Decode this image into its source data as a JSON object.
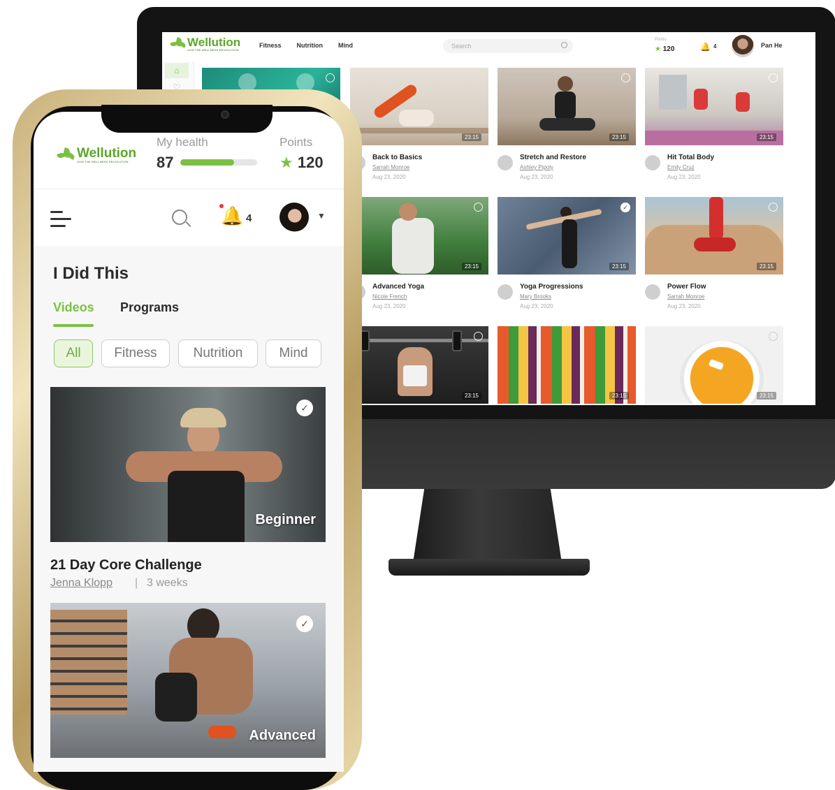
{
  "brand": {
    "name": "Wellution",
    "tagline": "JOIN THE WELLNESS REVOLUTION",
    "accent": "#7bc043"
  },
  "desktop": {
    "nav": [
      "Fitness",
      "Nutrition",
      "Mind"
    ],
    "search_placeholder": "Search",
    "points_label": "Points",
    "points_value": "120",
    "notifications": "4",
    "user_name": "Pan He",
    "rail_icons": [
      "home-icon",
      "heart-icon"
    ],
    "videos": [
      {
        "title": "",
        "author": "",
        "date": "",
        "duration": "",
        "status": "clock"
      },
      {
        "title": "Back to Basics",
        "author": "Sarrah Monroe",
        "date": "Aug 23, 2020",
        "duration": "23:15",
        "status": ""
      },
      {
        "title": "Stretch and Restore",
        "author": "Ashley Pipoly",
        "date": "Aug 23, 2020",
        "duration": "23:15",
        "status": "clock"
      },
      {
        "title": "Hit Total Body",
        "author": "Emily Cruz",
        "date": "Aug 23, 2020",
        "duration": "23:15",
        "status": "clock"
      },
      {
        "title": "Advanced Yoga",
        "author": "Nicole French",
        "date": "Aug 23, 2020",
        "duration": "23:15",
        "status": "clock"
      },
      {
        "title": "Yoga Progressions",
        "author": "Mary Brooks",
        "date": "Aug 23, 2020",
        "duration": "23:15",
        "status": "check"
      },
      {
        "title": "Power Flow",
        "author": "Sarrah Monroe",
        "date": "Aug 23, 2020",
        "duration": "23:15",
        "status": "clock"
      },
      {
        "title": "",
        "author": "",
        "date": "",
        "duration": "23:15",
        "status": "clock"
      },
      {
        "title": "",
        "author": "",
        "date": "",
        "duration": "23:15",
        "status": ""
      },
      {
        "title": "",
        "author": "",
        "date": "",
        "duration": "23:15",
        "status": "clock"
      }
    ]
  },
  "mobile": {
    "health_label": "My health",
    "health_value": "87",
    "health_progress": 0.7,
    "points_label": "Points",
    "points_value": "120",
    "notifications": "4",
    "section_title": "I Did This",
    "tabs": [
      "Videos",
      "Programs"
    ],
    "active_tab": "Videos",
    "filters": [
      "All",
      "Fitness",
      "Nutrition",
      "Mind"
    ],
    "active_filter": "All",
    "cards": [
      {
        "level": "Beginner",
        "title": "21 Day Core Challenge",
        "author": "Jenna Klopp",
        "duration": "3 weeks",
        "completed": true
      },
      {
        "level": "Advanced",
        "title": "",
        "author": "",
        "duration": "",
        "completed": true
      }
    ]
  }
}
